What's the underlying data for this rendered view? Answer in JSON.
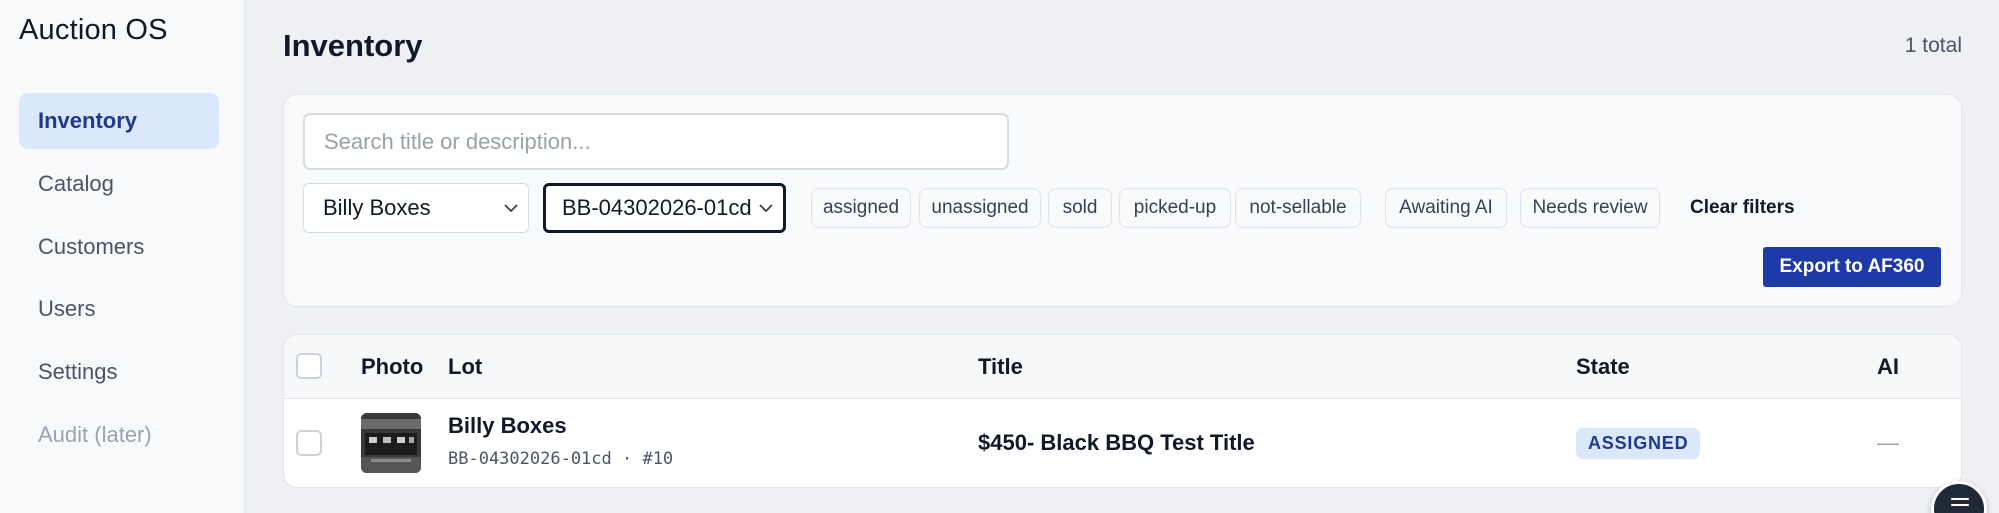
{
  "app": {
    "brand": "Auction OS"
  },
  "sidebar": {
    "items": [
      {
        "label": "Inventory",
        "active": true
      },
      {
        "label": "Catalog"
      },
      {
        "label": "Customers"
      },
      {
        "label": "Users"
      },
      {
        "label": "Settings"
      },
      {
        "label": "Audit (later)",
        "disabled": true
      }
    ]
  },
  "header": {
    "title": "Inventory",
    "count": "1 total"
  },
  "filters": {
    "search_placeholder": "Search title or description...",
    "search_value": "",
    "customer_select": "Billy Boxes",
    "batch_select": "BB-04302026-01cd",
    "state_chips": [
      "assigned",
      "unassigned",
      "sold",
      "picked-up",
      "not-sellable"
    ],
    "ai_chips": [
      "Awaiting AI",
      "Needs review"
    ],
    "clear_label": "Clear filters",
    "export_label": "Export to AF360"
  },
  "table": {
    "columns": [
      "Photo",
      "Lot",
      "Title",
      "State",
      "AI"
    ],
    "rows": [
      {
        "lot_name": "Billy Boxes",
        "lot_code": "BB-04302026-01cd · #10",
        "title": "$450- Black BBQ Test Title",
        "state": "ASSIGNED",
        "ai": "—"
      }
    ]
  },
  "colors": {
    "accent": "#1e3aa8",
    "active_nav_bg": "#dbe7fb",
    "badge_bg": "#dbe7fb",
    "badge_text": "#1e3a8a"
  },
  "icons": {
    "select_caret": "chevron-down-icon",
    "fab": "menu-icon"
  }
}
